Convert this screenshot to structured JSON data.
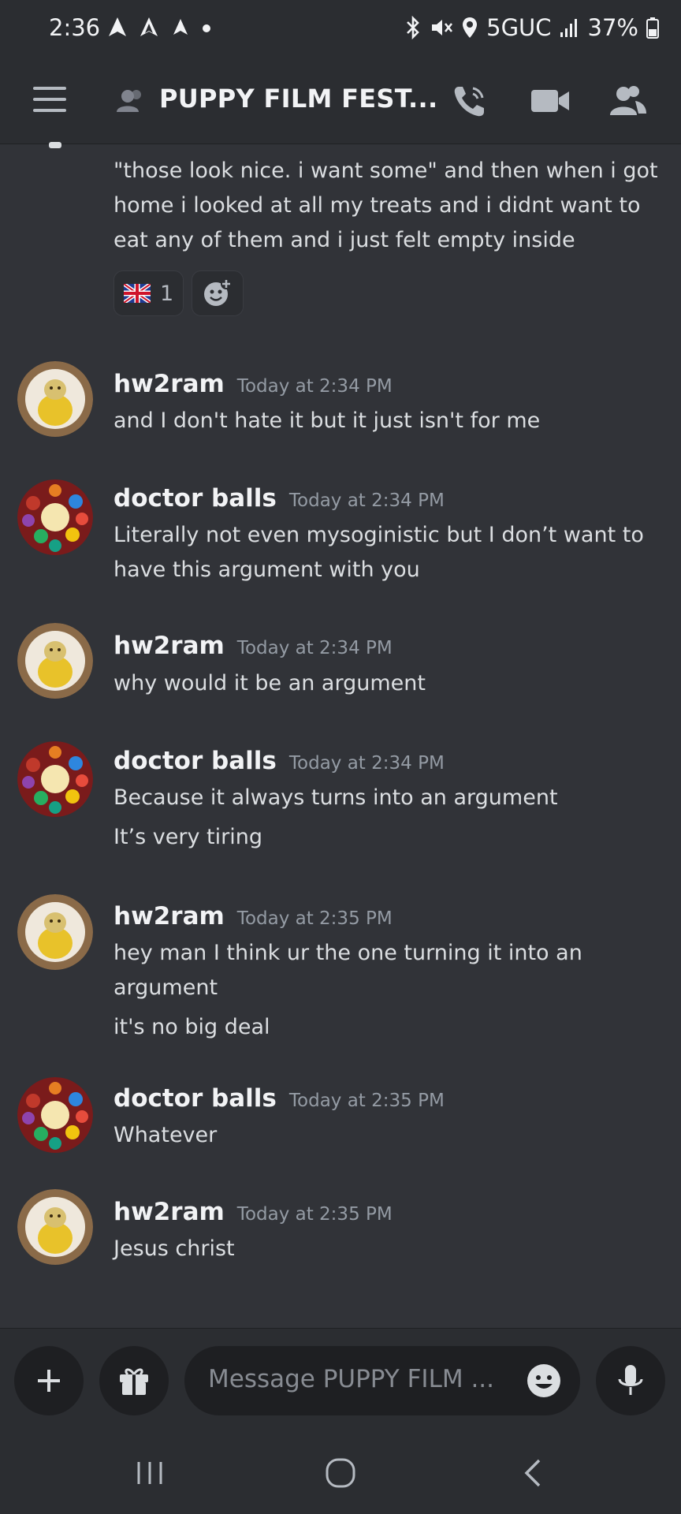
{
  "status_bar": {
    "time": "2:36",
    "network": "5GUC",
    "battery": "37%"
  },
  "header": {
    "channel_title": "PUPPY FILM FEST..."
  },
  "prior_message": {
    "lines": [
      "\"those look nice. i want some\" and then when i got",
      "home i looked at all my treats and i didnt want to",
      "eat any of them and i just felt empty inside"
    ],
    "reactions": [
      {
        "emoji": "flag-gb-icon",
        "count": "1"
      }
    ]
  },
  "messages": [
    {
      "author": "hw2ram",
      "timestamp": "Today at 2:34 PM",
      "lines": [
        "and I don't hate it but it just isn't for me"
      ]
    },
    {
      "author": "doctor balls",
      "timestamp": "Today at 2:34 PM",
      "lines": [
        "Literally not even mysoginistic but I don’t want to",
        "have this argument with you"
      ]
    },
    {
      "author": "hw2ram",
      "timestamp": "Today at 2:34 PM",
      "lines": [
        "why would it be an argument"
      ]
    },
    {
      "author": "doctor balls",
      "timestamp": "Today at 2:34 PM",
      "lines": [
        "Because it always turns into an argument",
        "It’s very tiring"
      ]
    },
    {
      "author": "hw2ram",
      "timestamp": "Today at 2:35 PM",
      "lines": [
        "hey man I think ur the one turning it into an",
        "argument",
        "it's no big deal"
      ]
    },
    {
      "author": "doctor balls",
      "timestamp": "Today at 2:35 PM",
      "lines": [
        "Whatever"
      ]
    },
    {
      "author": "hw2ram",
      "timestamp": "Today at 2:35 PM",
      "lines": [
        "Jesus christ"
      ]
    }
  ],
  "composer": {
    "placeholder": "Message PUPPY FILM ..."
  },
  "colors": {
    "background": "#313338",
    "header": "#2b2d31",
    "input": "#1e1f22",
    "text": "#dbdee1",
    "muted": "#949ba4"
  }
}
